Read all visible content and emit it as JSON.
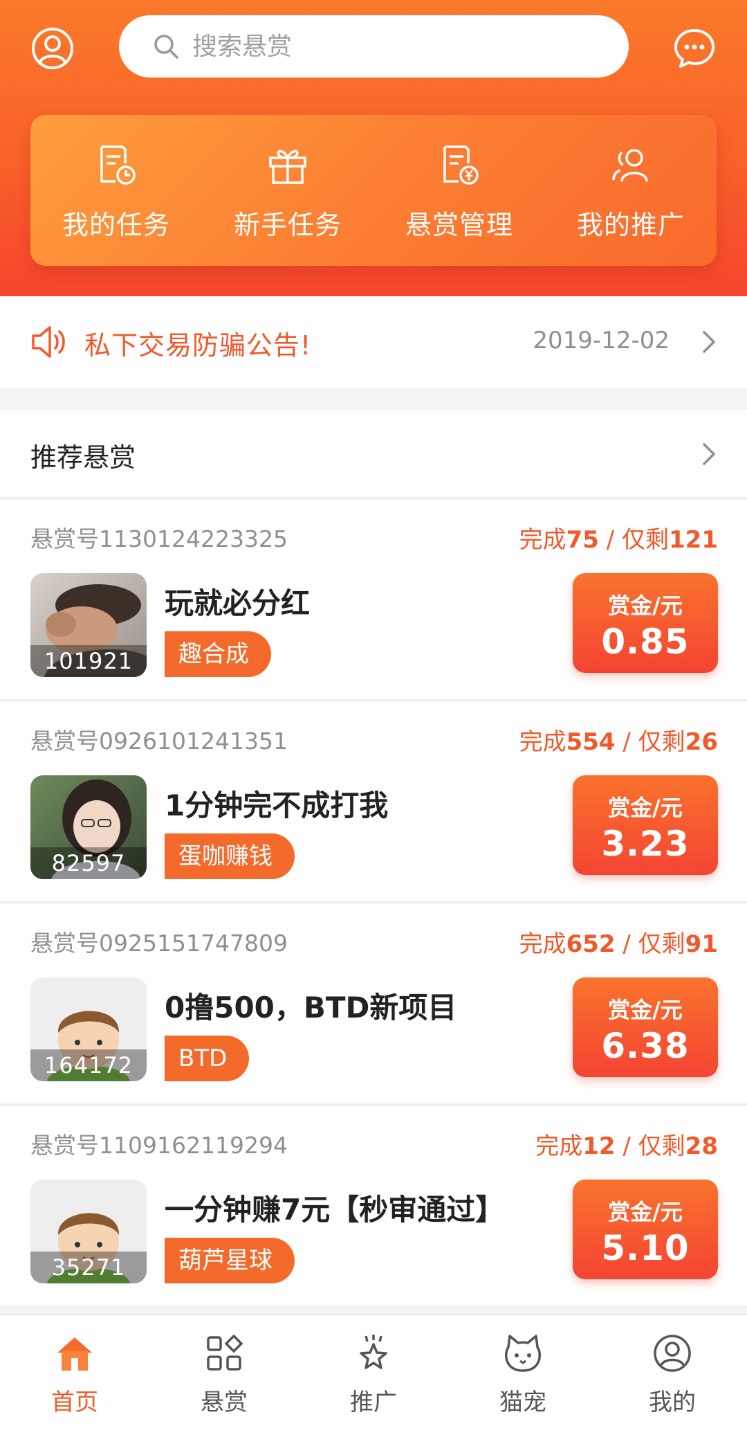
{
  "header": {
    "search_placeholder": "搜索悬赏",
    "profile_icon": "user-circle-icon",
    "message_icon": "chat-bubble-icon",
    "accent_color": "#f86129"
  },
  "quick_actions": [
    {
      "label": "我的任务",
      "icon": "task-clock-icon"
    },
    {
      "label": "新手任务",
      "icon": "gift-icon"
    },
    {
      "label": "悬赏管理",
      "icon": "reward-doc-icon"
    },
    {
      "label": "我的推广",
      "icon": "users-icon"
    }
  ],
  "notice": {
    "text": "私下交易防骗公告!",
    "date": "2019-12-02",
    "icon": "speaker-icon"
  },
  "recommended": {
    "title": "推荐悬赏"
  },
  "tasks": [
    {
      "id": "悬赏号1130124223325",
      "done_label": "完成",
      "done": "75",
      "sep": " / ",
      "left_label": "仅剩",
      "left": "121",
      "title": "玩就必分红",
      "tag": "趣合成",
      "count": "101921",
      "reward_label": "赏金/元",
      "reward": "0.85",
      "thumb": "photo-man"
    },
    {
      "id": "悬赏号0926101241351",
      "done_label": "完成",
      "done": "554",
      "sep": " / ",
      "left_label": "仅剩",
      "left": "26",
      "title": "1分钟完不成打我",
      "tag": "蛋咖赚钱",
      "count": "82597",
      "reward_label": "赏金/元",
      "reward": "3.23",
      "thumb": "photo-girl"
    },
    {
      "id": "悬赏号0925151747809",
      "done_label": "完成",
      "done": "652",
      "sep": " / ",
      "left_label": "仅剩",
      "left": "91",
      "title": "0撸500，BTD新项目",
      "tag": "BTD",
      "count": "164172",
      "reward_label": "赏金/元",
      "reward": "6.38",
      "thumb": "cartoon-boy"
    },
    {
      "id": "悬赏号1109162119294",
      "done_label": "完成",
      "done": "12",
      "sep": " / ",
      "left_label": "仅剩",
      "left": "28",
      "title": "一分钟赚7元【秒审通过】",
      "tag": "葫芦星球",
      "count": "35271",
      "reward_label": "赏金/元",
      "reward": "5.10",
      "thumb": "cartoon-boy"
    }
  ],
  "bottom_nav": [
    {
      "label": "首页",
      "icon": "home-icon",
      "active": true
    },
    {
      "label": "悬赏",
      "icon": "grid-icon",
      "active": false
    },
    {
      "label": "推广",
      "icon": "star-icon",
      "active": false
    },
    {
      "label": "猫宠",
      "icon": "cat-icon",
      "active": false
    },
    {
      "label": "我的",
      "icon": "profile-icon",
      "active": false
    }
  ]
}
